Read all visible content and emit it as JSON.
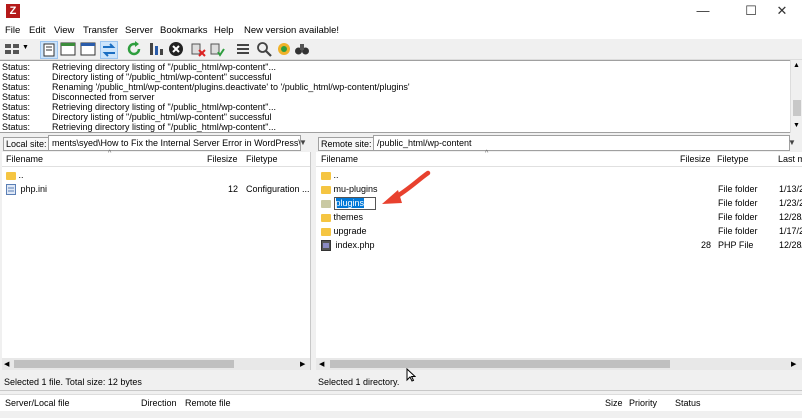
{
  "window": {
    "app_icon_letter": "Z",
    "minimize": "—",
    "maximize": "☐",
    "close": "✕"
  },
  "menu": [
    "File",
    "Edit",
    "View",
    "Transfer",
    "Server",
    "Bookmarks",
    "Help",
    "New version available!"
  ],
  "log": [
    {
      "k": "Status:",
      "v": "Retrieving directory listing of \"/public_html/wp-content\"..."
    },
    {
      "k": "Status:",
      "v": "Directory listing of \"/public_html/wp-content\" successful"
    },
    {
      "k": "Status:",
      "v": "Renaming '/public_html/wp-content/plugins.deactivate' to '/public_html/wp-content/plugins'"
    },
    {
      "k": "Status:",
      "v": "Disconnected from server"
    },
    {
      "k": "Status:",
      "v": "Retrieving directory listing of \"/public_html/wp-content\"..."
    },
    {
      "k": "Status:",
      "v": "Directory listing of \"/public_html/wp-content\" successful"
    },
    {
      "k": "Status:",
      "v": "Retrieving directory listing of \"/public_html/wp-content\"..."
    }
  ],
  "local": {
    "label": "Local site:",
    "path": "ments\\syed\\How to Fix the Internal Server Error in WordPress\\",
    "headers": {
      "filename": "Filename",
      "filesize": "Filesize",
      "filetype": "Filetype"
    },
    "rows": [
      {
        "name": "..",
        "size": "",
        "type": "",
        "icon": "folder"
      },
      {
        "name": "php.ini",
        "size": "12",
        "type": "Configuration ...",
        "icon": "ini"
      }
    ],
    "status": "Selected 1 file. Total size: 12 bytes"
  },
  "remote": {
    "label": "Remote site:",
    "path": "/public_html/wp-content",
    "headers": {
      "filename": "Filename",
      "filesize": "Filesize",
      "filetype": "Filetype",
      "lastmod": "Last m"
    },
    "rows": [
      {
        "name": "..",
        "size": "",
        "type": "",
        "date": "",
        "icon": "folder"
      },
      {
        "name": "mu-plugins",
        "size": "",
        "type": "File folder",
        "date": "1/13/2",
        "icon": "folder"
      },
      {
        "name": "plugins",
        "size": "",
        "type": "File folder",
        "date": "1/23/2",
        "icon": "folder-gray"
      },
      {
        "name": "themes",
        "size": "",
        "type": "File folder",
        "date": "12/28/",
        "icon": "folder"
      },
      {
        "name": "upgrade",
        "size": "",
        "type": "File folder",
        "date": "1/17/2",
        "icon": "folder"
      },
      {
        "name": "index.php",
        "size": "28",
        "type": "PHP File",
        "date": "12/28/",
        "icon": "php"
      }
    ],
    "status": "Selected 1 directory."
  },
  "queue": {
    "col1": "Server/Local file",
    "col2": "Direction",
    "col3": "Remote file",
    "col4": "Size",
    "col5": "Priority",
    "col6": "Status"
  },
  "colors": {
    "accent": "#0078d7",
    "folder": "#f5c542",
    "arrow": "#e8412e"
  }
}
